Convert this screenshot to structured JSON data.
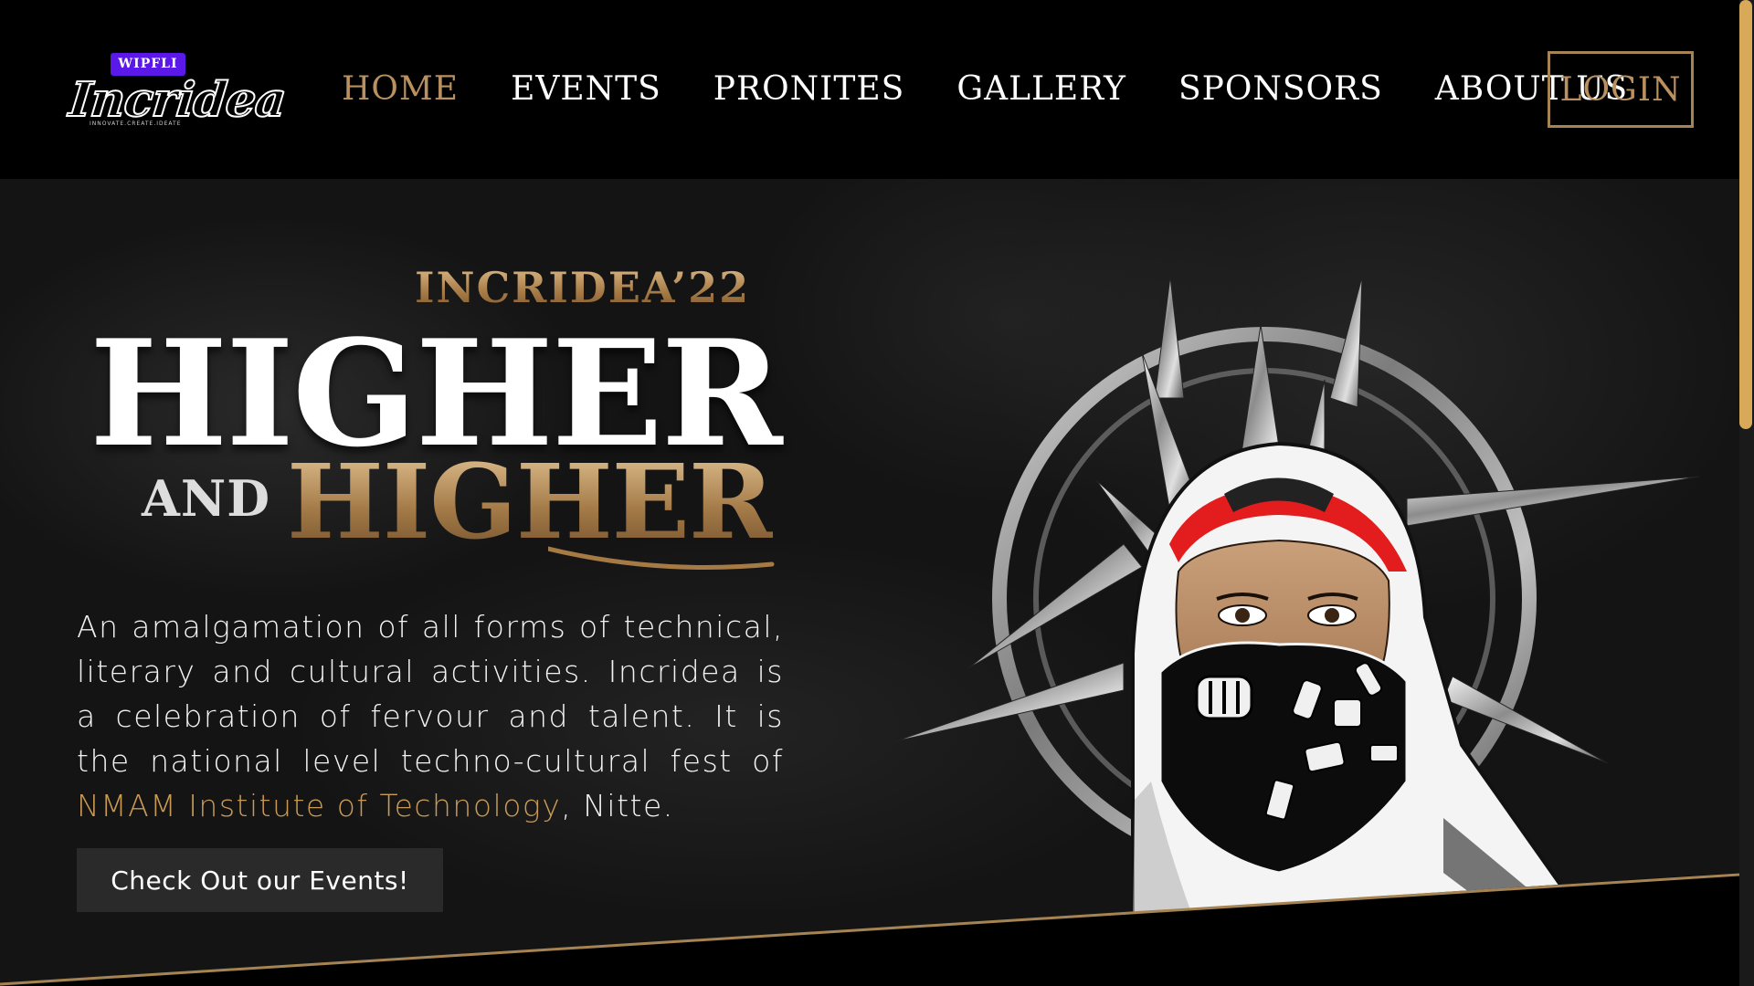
{
  "brand": {
    "badge": "WIPFLI",
    "name": "Incridea",
    "tagline": "INNOVATE.CREATE.IDEATE"
  },
  "nav": {
    "items": [
      {
        "label": "HOME",
        "active": true
      },
      {
        "label": "EVENTS",
        "active": false
      },
      {
        "label": "PRONITES",
        "active": false
      },
      {
        "label": "GALLERY",
        "active": false
      },
      {
        "label": "SPONSORS",
        "active": false
      },
      {
        "label": "ABOUT US",
        "active": false
      }
    ],
    "login_label": "LOGIN"
  },
  "hero": {
    "subtitle": "INCRIDEA’22",
    "line1": "HIGHER",
    "and": "AND",
    "line2": "HIGHER",
    "description_part1": "An amalgamation of all forms of technical, literary and cultural activities. Incridea is a celebration of fervour and talent. It is the national level techno-cultural fest of ",
    "description_link": "NMAM Institute of Technology",
    "description_part2": ", Nitte.",
    "cta_label": "Check Out our Events!",
    "art_icon": "hooded-masked-figure-emblem-icon"
  },
  "colors": {
    "accent_gold": "#b99160",
    "link_gold": "#c99a55",
    "logo_badge": "#5a19e8",
    "background": "#000000",
    "button_bg": "#2a2a2a",
    "scrollbar": "#d9a95a"
  }
}
